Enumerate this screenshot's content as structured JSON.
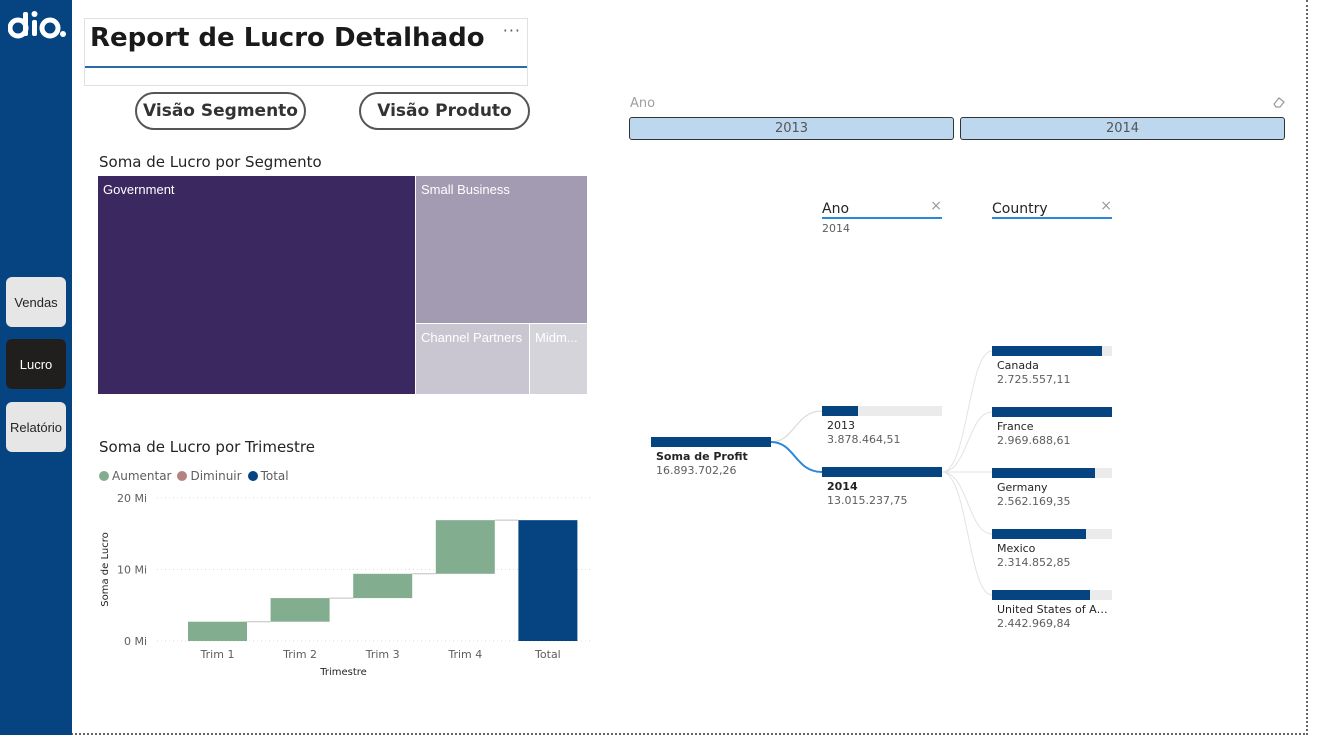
{
  "report": {
    "title": "Report de Lucro Detalhado",
    "more_options": "···"
  },
  "nav": [
    {
      "label": "Vendas",
      "active": false
    },
    {
      "label": "Lucro",
      "active": true
    },
    {
      "label": "Relatório",
      "active": false
    }
  ],
  "buttons": {
    "segmento": "Visão Segmento",
    "produto": "Visão Produto"
  },
  "treemap": {
    "title": "Soma de Lucro por Segmento",
    "cells": [
      {
        "label": "Government",
        "color": "#3b2861"
      },
      {
        "label": "Small Business",
        "color": "#a29bb2"
      },
      {
        "label": "Channel Partners",
        "color": "#c9c6d2"
      },
      {
        "label": "Midm...",
        "color": "#d6d4db"
      }
    ]
  },
  "slicer": {
    "header": "Ano",
    "options": [
      "2013",
      "2014"
    ]
  },
  "waterfall": {
    "title": "Soma de Lucro por Trimestre",
    "legend": [
      {
        "label": "Aumentar",
        "color": "#82ad8f"
      },
      {
        "label": "Diminuir",
        "color": "#b48380"
      },
      {
        "label": "Total",
        "color": "#054480"
      }
    ]
  },
  "chart_data": {
    "type": "bar",
    "subtype": "waterfall",
    "title": "Soma de Lucro por Trimestre",
    "xlabel": "Trimestre",
    "ylabel": "Soma de Lucro",
    "categories": [
      "Trim 1",
      "Trim 2",
      "Trim 3",
      "Trim 4",
      "Total"
    ],
    "series": [
      {
        "name": "Aumentar",
        "start": [
          0,
          2.7,
          6.0,
          9.4
        ],
        "end": [
          2.7,
          6.0,
          9.4,
          16.9
        ]
      },
      {
        "name": "Total",
        "start": [
          0
        ],
        "end": [
          16.9
        ]
      }
    ],
    "ytick_labels": [
      "0 Mi",
      "10 Mi",
      "20 Mi"
    ],
    "ytick_values": [
      0,
      10,
      20
    ],
    "ylim": [
      0,
      20
    ],
    "grid": true,
    "legend_position": "top-left"
  },
  "decomp": {
    "levels": [
      {
        "label": "Ano",
        "sub": "2014"
      },
      {
        "label": "Country",
        "sub": ""
      }
    ],
    "close": "×",
    "root": {
      "label": "Soma de Profit",
      "value": "16.893.702,26"
    },
    "years": [
      {
        "label": "2013",
        "value": "3.878.464,51",
        "fraction": 0.3,
        "bold": false
      },
      {
        "label": "2014",
        "value": "13.015.237,75",
        "fraction": 1.0,
        "bold": true
      }
    ],
    "countries": [
      {
        "label": "Canada",
        "value": "2.725.557,11",
        "fraction": 0.92
      },
      {
        "label": "France",
        "value": "2.969.688,61",
        "fraction": 1.0
      },
      {
        "label": "Germany",
        "value": "2.562.169,35",
        "fraction": 0.86
      },
      {
        "label": "Mexico",
        "value": "2.314.852,85",
        "fraction": 0.78
      },
      {
        "label": "United States of Am...",
        "value": "2.442.969,84",
        "fraction": 0.82
      }
    ]
  }
}
